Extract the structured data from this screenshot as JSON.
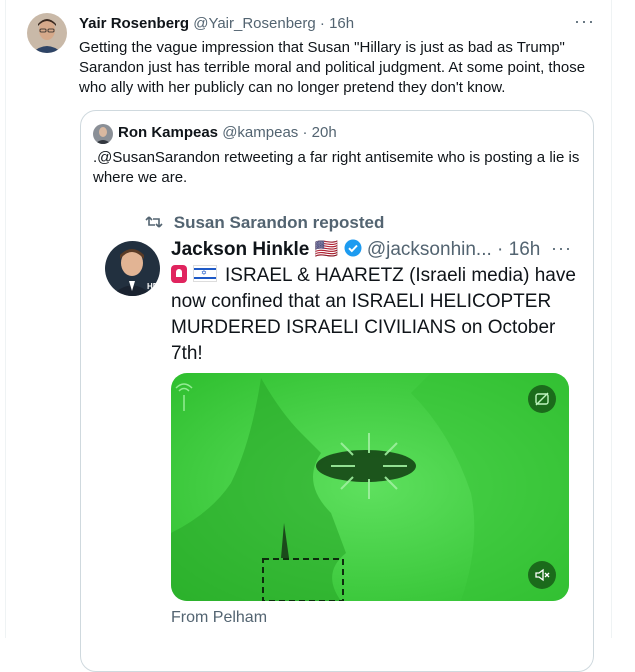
{
  "tweet": {
    "author_name": "Yair Rosenberg",
    "author_handle": "@Yair_Rosenberg",
    "time": "· 16h",
    "text": "Getting the vague impression that Susan \"Hillary is just as bad as Trump\" Sarandon just has terrible moral and political judgment. At some point, those who ally with her publicly can no longer pretend they don't know.",
    "more_label": "···"
  },
  "quote": {
    "author_name": "Ron Kampeas",
    "author_handle": "@kampeas",
    "time": "· 20h",
    "text": ".@SusanSarandon retweeting a far right antisemite who is posting a lie is where we are."
  },
  "reposted": {
    "label": "Susan Sarandon reposted",
    "author_name": "Jackson Hinkle",
    "flag": "🇺🇸",
    "author_handle": "@jacksonhin...",
    "time": "· 16h",
    "more_label": "···",
    "text": "ISRAEL & HAARETZ (Israeli media) have now confined that an ISRAELI HELICOPTER MURDERED ISRAELI CIVILIANS on October 7th!",
    "media_caption": "From Pelham",
    "colors": {
      "verified": "#1d9bf0",
      "video_bg": "#3fd33f"
    },
    "icons": [
      "siren-icon",
      "israel-flag-icon",
      "verified-badge-icon",
      "repost-icon",
      "mute-icon",
      "sensitive-media-icon"
    ]
  }
}
